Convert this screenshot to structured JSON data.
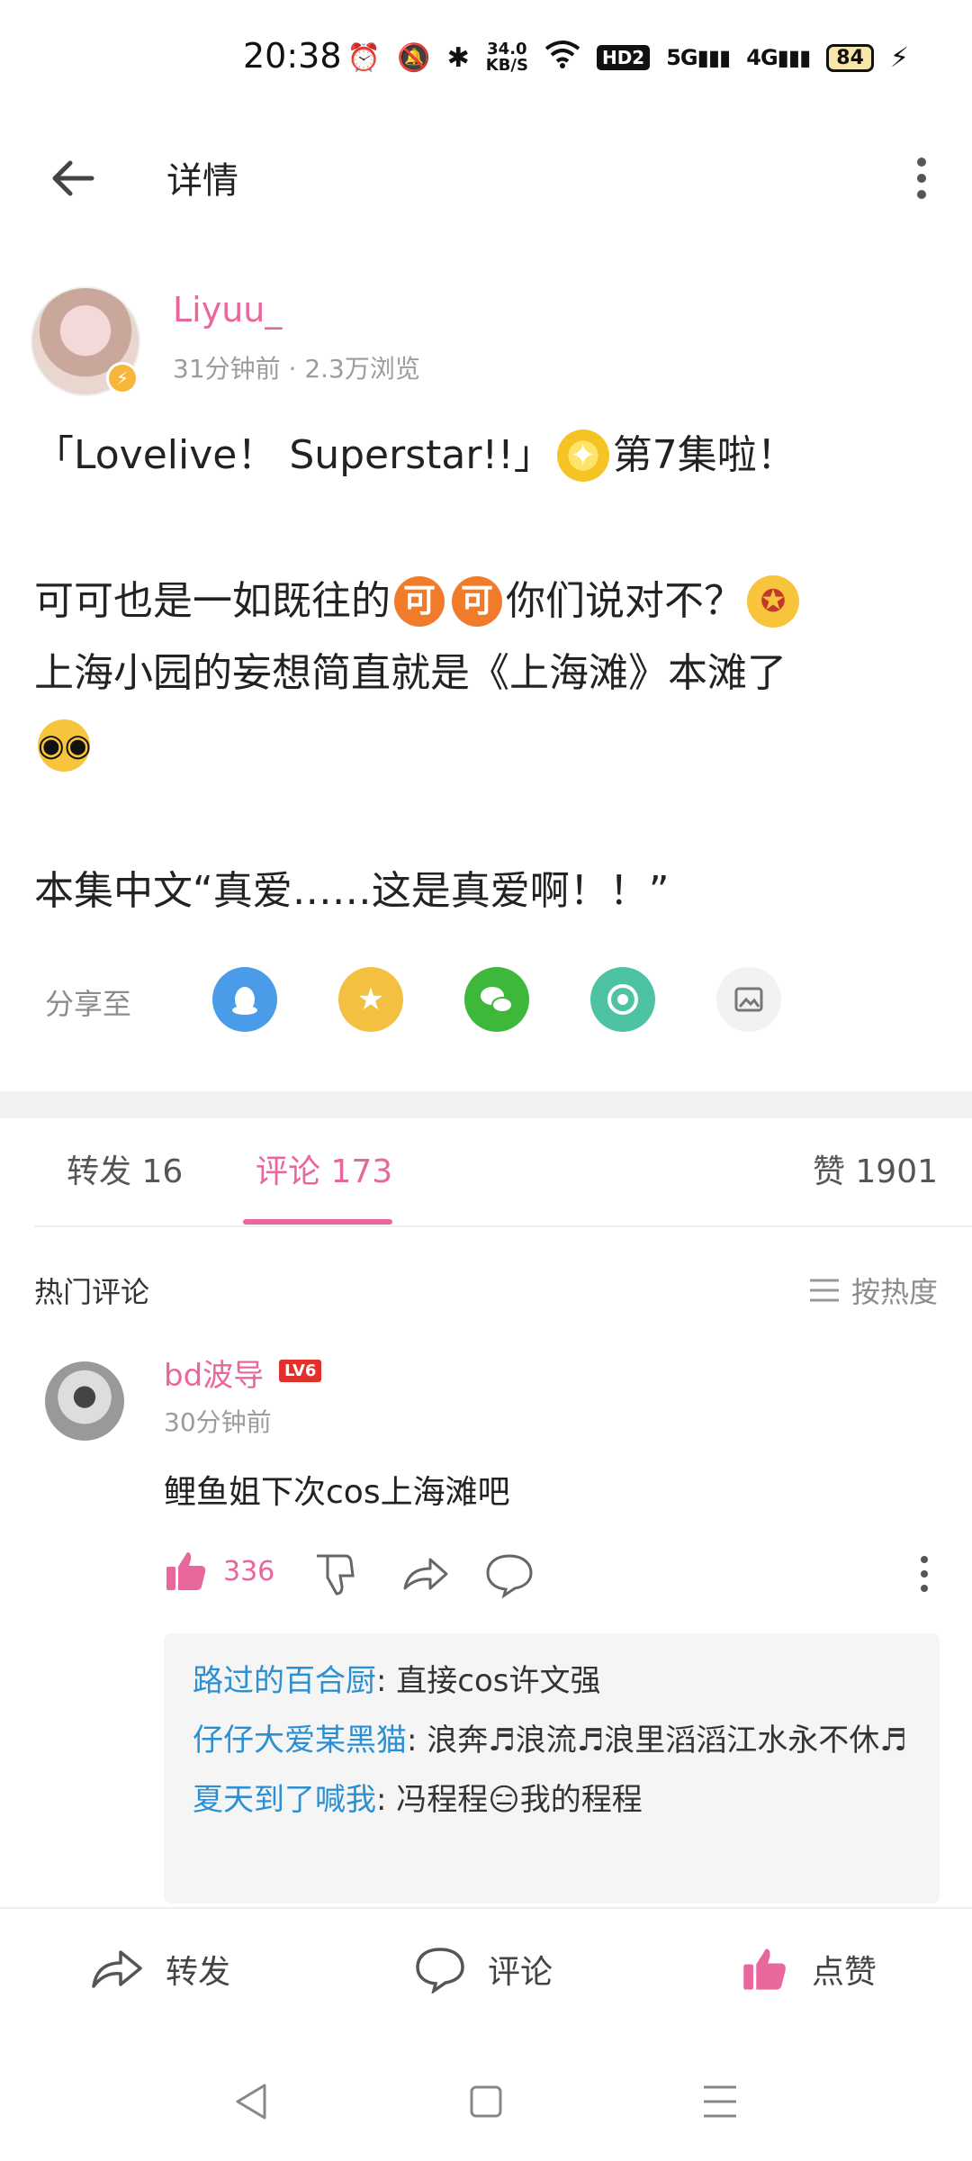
{
  "status_bar": {
    "time": "20:38",
    "net_speed_value": "34.0",
    "net_speed_unit": "KB/S",
    "hd_label": "HD2",
    "sig1_label": "5G",
    "sig2_label": "4G",
    "battery": "84"
  },
  "header": {
    "title": "详情"
  },
  "author": {
    "name": "Liyuu_",
    "meta": "31分钟前 · 2.3万浏览"
  },
  "post": {
    "line1_text": "「Lovelive！ Superstar!!」",
    "line1_suffix": "第7集啦！",
    "line2_prefix": "可可也是一如既往的",
    "ke_glyph": "可",
    "line2_suffix": "你们说对不？",
    "line3": "上海小园的妄想简直就是《上海滩》本滩了",
    "line4": "本集中文“真爱……这是真爱啊！！”"
  },
  "share": {
    "label": "分享至"
  },
  "tabs": {
    "forward": "转发 16",
    "comments": "评论 173",
    "likes": "赞 1901"
  },
  "hot_comments": {
    "title": "热门评论",
    "sort_label": "按热度"
  },
  "comment": {
    "user": "bd波导",
    "level": "LV6",
    "time": "30分钟前",
    "text": "鲤鱼姐下次cos上海滩吧",
    "like_count": "336",
    "replies": [
      {
        "user": "路过的百合厨",
        "text": ": 直接cos许文强"
      },
      {
        "user": "仔仔大爱某黑猫",
        "text": ": 浪奔♬浪流♬浪里滔滔江水永不休♬"
      },
      {
        "user": "夏天到了喊我",
        "text": ": 冯程程😑我的程程"
      }
    ]
  },
  "bottom_bar": {
    "forward": "转发",
    "comment": "评论",
    "like": "点赞"
  },
  "colors": {
    "accent_pink": "#e8679c",
    "reply_user_blue": "#2b8fd1",
    "qq_blue": "#4a9be8",
    "qzone_yellow": "#f4c041",
    "wechat_green": "#3eb83b",
    "moments_teal": "#4dc3a3"
  }
}
